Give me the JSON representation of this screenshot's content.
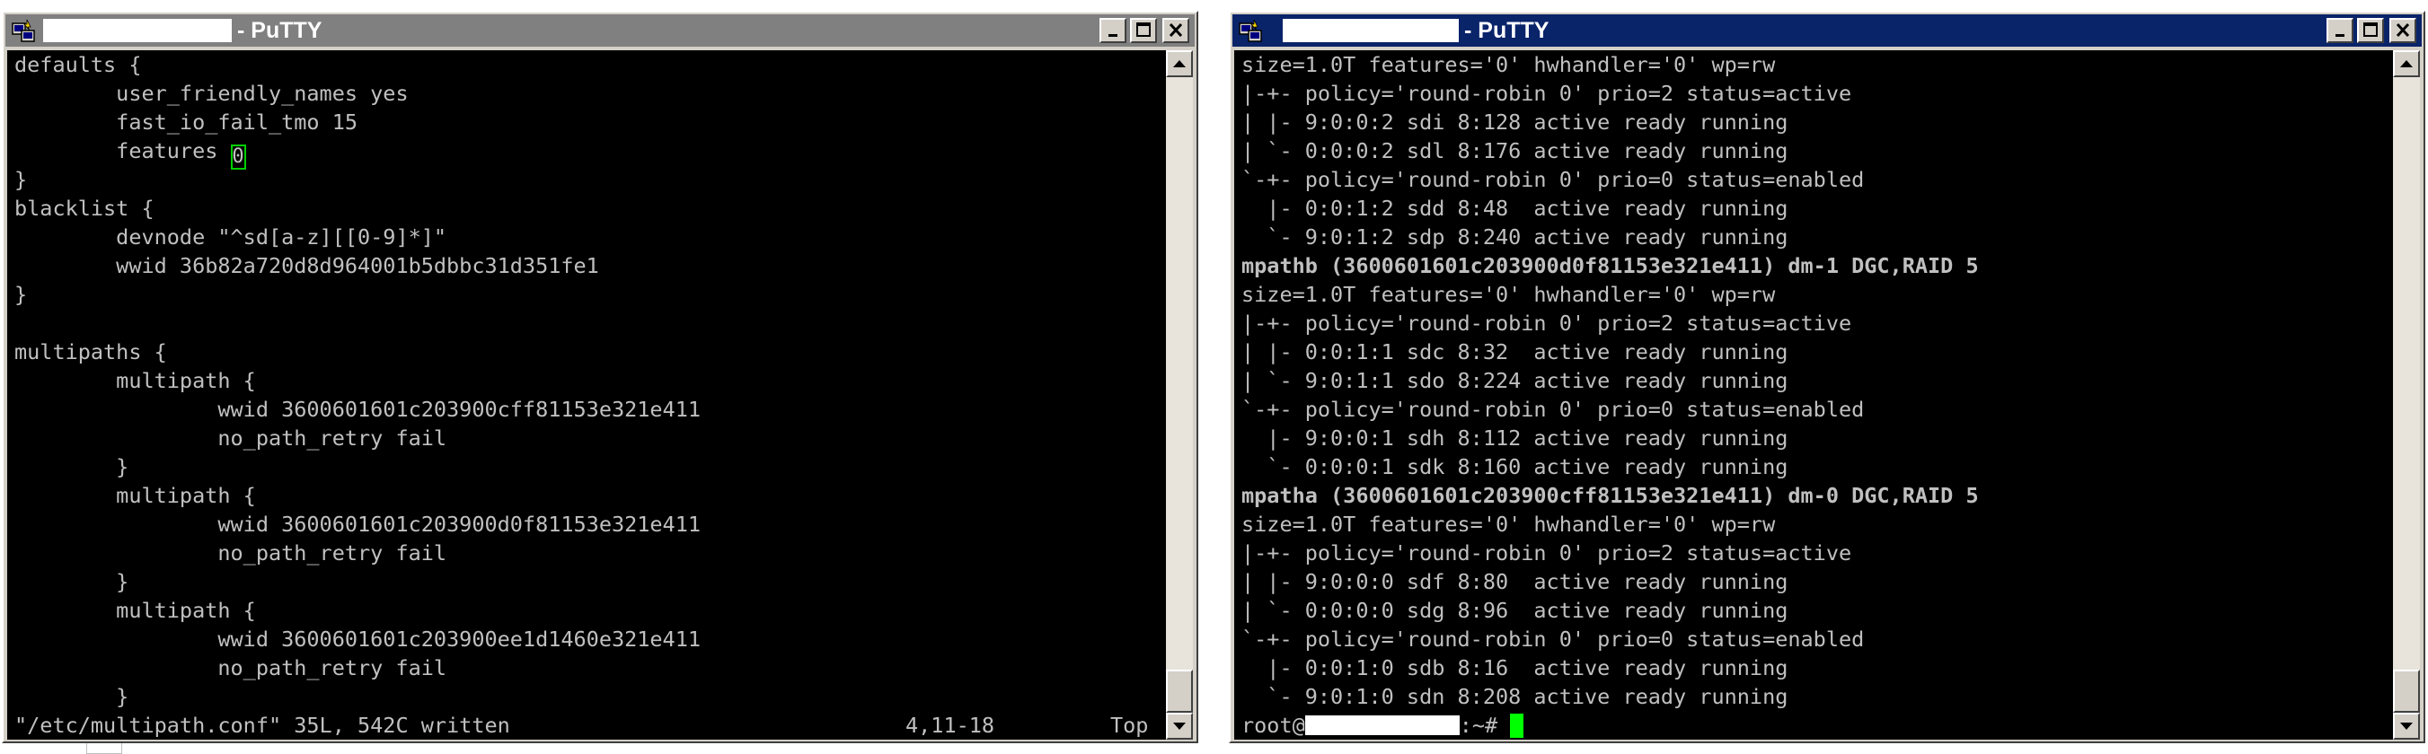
{
  "left_window": {
    "title": "- PuTTY",
    "lines": [
      "defaults {",
      "        user_friendly_names yes",
      "        fast_io_fail_tmo 15",
      "        features ",
      "}",
      "blacklist {",
      "        devnode \"^sd[a-z][[0-9]*]\"",
      "        wwid 36b82a720d8d964001b5dbbc31d351fe1",
      "}",
      "",
      "multipaths {",
      "        multipath {",
      "                wwid 3600601601c203900cff81153e321e411",
      "                no_path_retry fail",
      "        }",
      "        multipath {",
      "                wwid 3600601601c203900d0f81153e321e411",
      "                no_path_retry fail",
      "        }",
      "        multipath {",
      "                wwid 3600601601c203900ee1d1460e321e411",
      "                no_path_retry fail",
      "        }"
    ],
    "cursor_char": "0",
    "status_file": "\"/etc/multipath.conf\" 35L, 542C written",
    "status_pos": "4,11-18",
    "status_top": "Top"
  },
  "right_window": {
    "title": "- PuTTY",
    "lines": [
      "size=1.0T features='0' hwhandler='0' wp=rw",
      "|-+- policy='round-robin 0' prio=2 status=active",
      "| |- 9:0:0:2 sdi 8:128 active ready running",
      "| `- 0:0:0:2 sdl 8:176 active ready running",
      "`-+- policy='round-robin 0' prio=0 status=enabled",
      "  |- 0:0:1:2 sdd 8:48  active ready running",
      "  `- 9:0:1:2 sdp 8:240 active ready running",
      "mpathb (3600601601c203900d0f81153e321e411) dm-1 DGC,RAID 5",
      "size=1.0T features='0' hwhandler='0' wp=rw",
      "|-+- policy='round-robin 0' prio=2 status=active",
      "| |- 0:0:1:1 sdc 8:32  active ready running",
      "| `- 9:0:1:1 sdo 8:224 active ready running",
      "`-+- policy='round-robin 0' prio=0 status=enabled",
      "  |- 9:0:0:1 sdh 8:112 active ready running",
      "  `- 0:0:0:1 sdk 8:160 active ready running",
      "mpatha (3600601601c203900cff81153e321e411) dm-0 DGC,RAID 5",
      "size=1.0T features='0' hwhandler='0' wp=rw",
      "|-+- policy='round-robin 0' prio=2 status=active",
      "| |- 9:0:0:0 sdf 8:80  active ready running",
      "| `- 0:0:0:0 sdg 8:96  active ready running",
      "`-+- policy='round-robin 0' prio=0 status=enabled",
      "  |- 0:0:1:0 sdb 8:16  active ready running",
      "  `- 9:0:1:0 sdn 8:208 active ready running"
    ],
    "prompt_prefix": "root@",
    "prompt_suffix": ":~#"
  },
  "colors": {
    "terminal_bg": "#000000",
    "terminal_fg": "#c0c0c0",
    "cursor": "#00ff00",
    "title_active": "#0a246a",
    "title_inactive": "#808080"
  },
  "icons": [
    "putty-icon",
    "minimize-icon",
    "maximize-icon",
    "close-icon",
    "scroll-up-arrow-icon",
    "scroll-down-arrow-icon"
  ]
}
